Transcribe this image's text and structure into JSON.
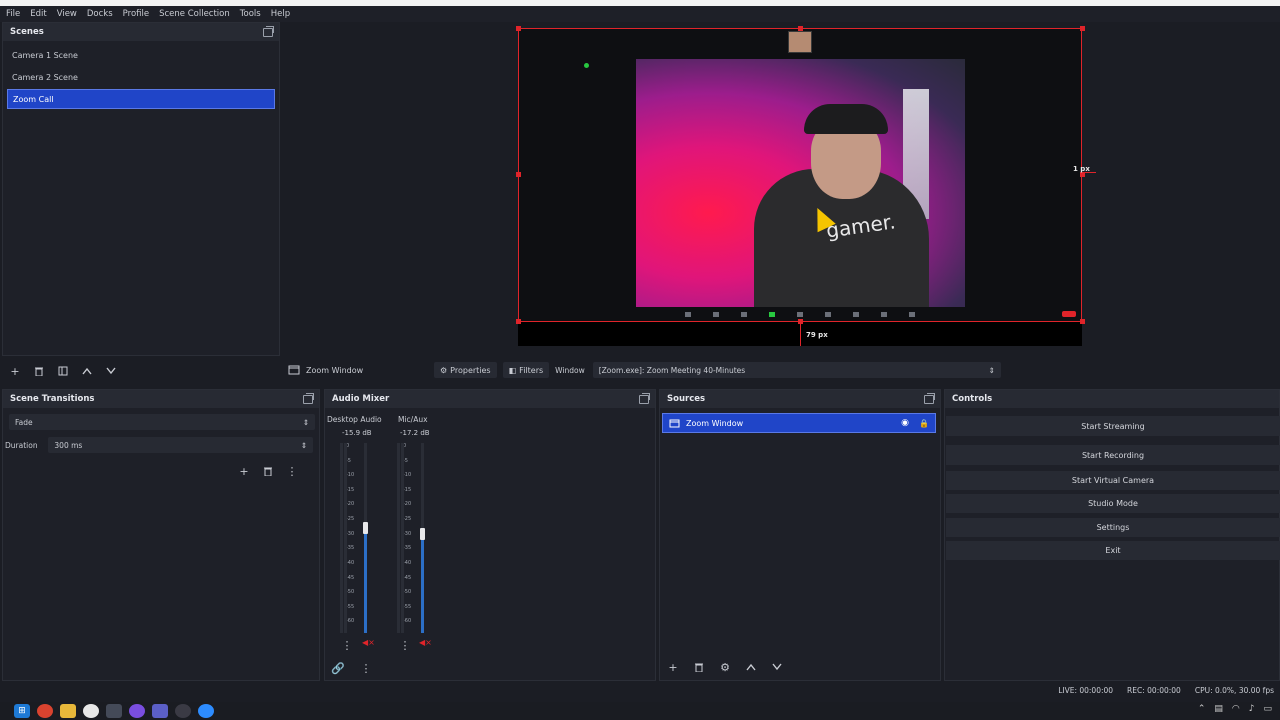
{
  "menu": [
    "File",
    "Edit",
    "View",
    "Docks",
    "Profile",
    "Scene Collection",
    "Tools",
    "Help"
  ],
  "scenes": {
    "title": "Scenes",
    "items": [
      "Camera 1 Scene",
      "Camera 2 Scene",
      "Zoom Call"
    ],
    "active_index": 2
  },
  "preview": {
    "shirt_text": "gamer.",
    "px_right": "1 px",
    "px_bottom": "79 px"
  },
  "props_bar": {
    "source_name": "Zoom Window",
    "properties_label": "Properties",
    "filters_label": "Filters",
    "window_label": "Window",
    "window_value": "[Zoom.exe]: Zoom Meeting 40-Minutes"
  },
  "transitions": {
    "title": "Scene Transitions",
    "type": "Fade",
    "duration_label": "Duration",
    "duration_value": "300 ms"
  },
  "mixer": {
    "title": "Audio Mixer",
    "channels": [
      {
        "name": "Desktop Audio",
        "db": "-15.9 dB",
        "level": 0.55
      },
      {
        "name": "Mic/Aux",
        "db": "-17.2 dB",
        "level": 0.52
      }
    ],
    "scale": [
      "0",
      "-5",
      "-10",
      "-15",
      "-20",
      "-25",
      "-30",
      "-35",
      "-40",
      "-45",
      "-50",
      "-55",
      "-60"
    ]
  },
  "sources": {
    "title": "Sources",
    "items": [
      "Zoom Window"
    ]
  },
  "controls": {
    "title": "Controls",
    "buttons": [
      "Start Streaming",
      "Start Recording",
      "Start Virtual Camera",
      "Studio Mode",
      "Settings",
      "Exit"
    ]
  },
  "status": {
    "live": "LIVE: 00:00:00",
    "rec": "REC: 00:00:00",
    "cpu": "CPU: 0.0%, 30.00 fps"
  },
  "colors": {
    "accent": "#2045c8",
    "selection_border": "#e0242a",
    "meter": "#2c6fc7"
  }
}
